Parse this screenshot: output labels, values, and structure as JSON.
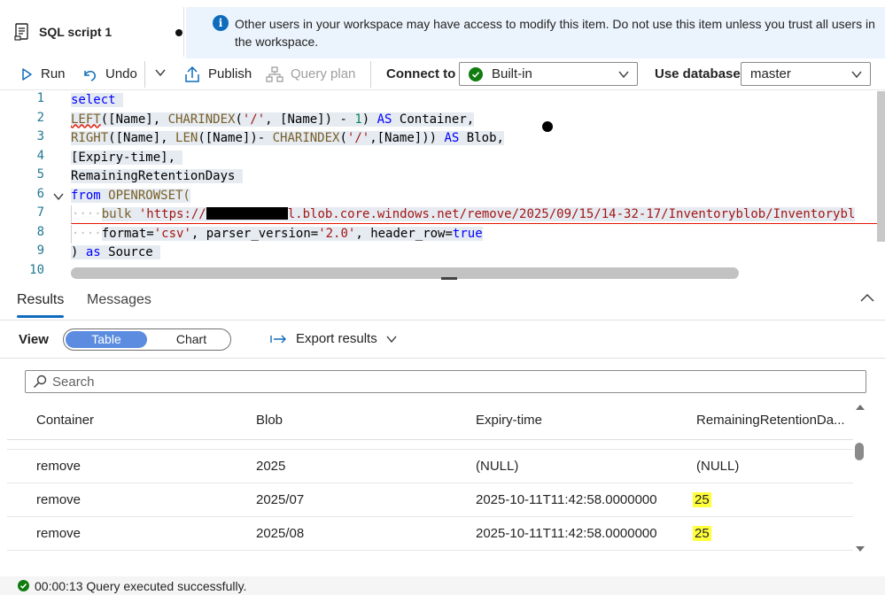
{
  "tab": {
    "title": "SQL script 1"
  },
  "banner": {
    "message": "Other users in your workspace may have access to modify this item. Do not use this item unless you trust all users in the workspace."
  },
  "toolbar": {
    "run": "Run",
    "undo": "Undo",
    "publish": "Publish",
    "query_plan": "Query plan",
    "connect_to_label": "Connect to",
    "connect_value": "Built-in",
    "use_db_label": "Use database",
    "db_value": "master"
  },
  "editor": {
    "line_numbers": [
      "1",
      "2",
      "3",
      "4",
      "5",
      "6",
      "7",
      "8",
      "9",
      "10"
    ],
    "lines": {
      "l1": "select",
      "l2a": "LEFT",
      "l2b": "([Name], ",
      "l2c": "CHARINDEX",
      "l2d": "(",
      "l2e": "'/'",
      "l2f": ", [Name]) - ",
      "l2g": "1",
      "l2h": ") ",
      "l2i": "AS",
      "l2j": " Container,",
      "l3a": "RIGHT",
      "l3b": "([Name], ",
      "l3c": "LEN",
      "l3d": "([Name])- ",
      "l3e": "CHARINDEX",
      "l3f": "(",
      "l3g": "'/'",
      "l3h": ",[Name])) ",
      "l3i": "AS",
      "l3j": " Blob,",
      "l4": "[Expiry-time],",
      "l5": "RemainingRetentionDays",
      "l6a": "from",
      "l6b": " OPENROWSET(",
      "l7a": "bulk",
      "l7b": "'https://",
      "l7c": "l.blob.core.windows.net/remove/2025/09/15/14-32-17/Inventoryblob/Inventorybl",
      "l8a": "format",
      "l8b": "=",
      "l8c": "'csv'",
      "l8d": ", parser_version=",
      "l8e": "'2.0'",
      "l8f": ", header_row=",
      "l8g": "true",
      "l9a": ") ",
      "l9b": "as",
      "l9c": " Source"
    }
  },
  "results": {
    "tabs": [
      "Results",
      "Messages"
    ],
    "view_label": "View",
    "view_options": [
      "Table",
      "Chart"
    ],
    "export": "Export results",
    "search_placeholder": "Search",
    "columns": [
      "Container",
      "Blob",
      "Expiry-time",
      "RemainingRetentionDa..."
    ],
    "rows": [
      [
        "remove",
        "2025",
        "(NULL)",
        "(NULL)"
      ],
      [
        "remove",
        "2025/07",
        "2025-10-11T11:42:58.0000000",
        "25"
      ],
      [
        "remove",
        "2025/08",
        "2025-10-11T11:42:58.0000000",
        "25"
      ]
    ]
  },
  "status": {
    "text": "00:00:13 Query executed successfully."
  },
  "colors": {
    "accent": "#0f6cbd",
    "keyword": "#0000ff",
    "string": "#a31515",
    "success": "#107c10",
    "highlight": "#ffff3a"
  }
}
